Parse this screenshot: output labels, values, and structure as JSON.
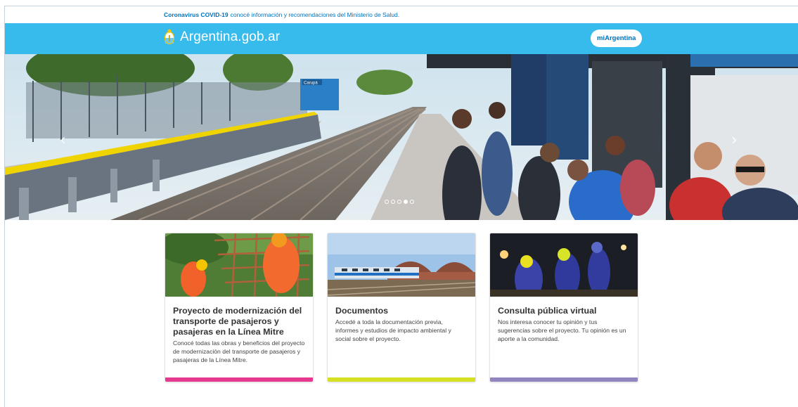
{
  "alert": {
    "strong": "Coronavirus COVID-19",
    "text": "conocé información y recomendaciones del Ministerio de Salud."
  },
  "header": {
    "brand": "Argentina.gob.ar",
    "account_button": "miArgentina"
  },
  "hero": {
    "station_sign": "Carupá",
    "slides": 5,
    "active_slide": 4
  },
  "cards": [
    {
      "title": "Proyecto de modernización del transporte de pasajeros y pasajeras en la Línea Mitre",
      "description": "Conocé todas las obras y beneficios del proyecto de modernización del transporte de pasajeros y pasajeras de la Línea Mitre.",
      "stripe_color": "#e7388f"
    },
    {
      "title": "Documentos",
      "description": "Accedé a toda la documentación previa, informes y estudios de impacto ambiental y social sobre el proyecto.",
      "stripe_color": "#d7df23"
    },
    {
      "title": "Consulta pública virtual",
      "description": "Nos interesa conocer tu opinión y tus sugerencias sobre el proyecto. Tu opinión es un aporte a la comunidad.",
      "stripe_color": "#9284be"
    }
  ],
  "colors": {
    "header": "#37bbed",
    "link": "#0072bb"
  }
}
